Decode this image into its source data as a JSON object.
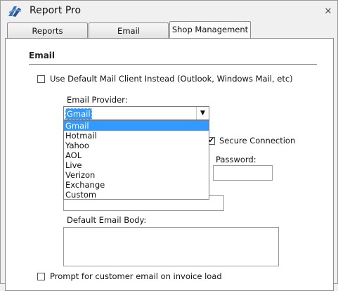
{
  "window": {
    "title": "Report Pro",
    "close_glyph": "✕"
  },
  "tabs": [
    {
      "label": "Reports"
    },
    {
      "label": "Email"
    },
    {
      "label": "Shop Management"
    }
  ],
  "email": {
    "section_title": "Email",
    "use_default_client_label": "Use Default Mail Client Instead (Outlook, Windows Mail, etc)",
    "provider_label": "Email Provider:",
    "provider_selected": "Gmail",
    "provider_options": [
      "Gmail",
      "Hotmail",
      "Yahoo",
      "AOL",
      "Live",
      "Verizon",
      "Exchange",
      "Custom"
    ],
    "secure_connection_label": "Secure Connection",
    "password_label": "Password:",
    "default_body_label": "Default Email Body:",
    "prompt_label": "Prompt for customer email on invoice load"
  },
  "colors": {
    "selection": "#3399ff",
    "panel_bg": "#ffffff",
    "window_bg": "#f0f0f0"
  },
  "icons": {
    "app": "app-logo-icon",
    "close": "close-icon",
    "dropdown": "chevron-down-icon"
  }
}
